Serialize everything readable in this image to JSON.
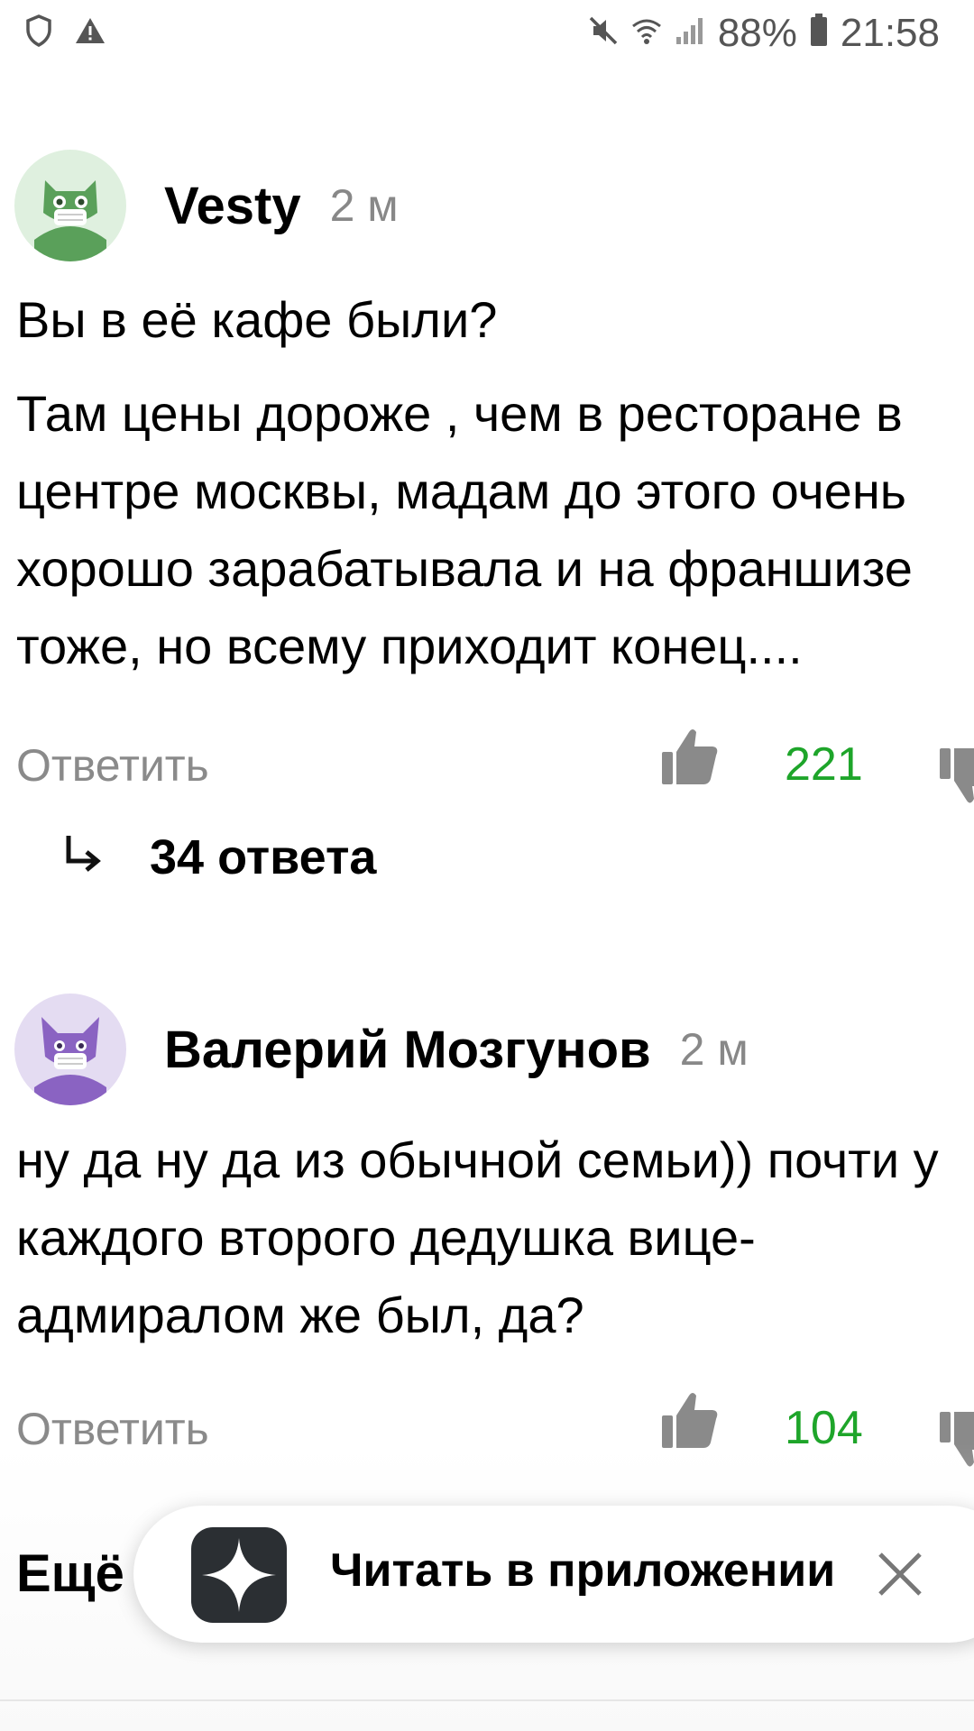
{
  "status_bar": {
    "battery": "88%",
    "time": "21:58"
  },
  "comments": [
    {
      "author": "Vesty",
      "time": "2 м",
      "lines": [
        "Вы в её кафе были?",
        "Там цены дороже , чем в ресторане в",
        "центре москвы, мадам до этого очень",
        "хорошо зарабатывала и на франшизе",
        "тоже, но всему приходит конец...."
      ],
      "reply_label": "Ответить",
      "likes": "221",
      "avatar_color": "#5aa05a",
      "avatar_bg": "#dff0df"
    },
    {
      "author": "Валерий Мозгунов",
      "time": "2 м",
      "lines": [
        "ну да ну да из обычной семьи)) почти у",
        "каждого второго дедушка вице-",
        "адмиралом же был, да?"
      ],
      "reply_label": "Ответить",
      "likes": "104",
      "avatar_color": "#8a63c2",
      "avatar_bg": "#e4dcf2"
    }
  ],
  "replies": {
    "label": "34 ответа"
  },
  "more_label": "Ещё",
  "banner": {
    "label": "Читать в приложении"
  },
  "colors": {
    "likes_green": "#1ea52a",
    "muted_gray": "#8a8a8a"
  }
}
